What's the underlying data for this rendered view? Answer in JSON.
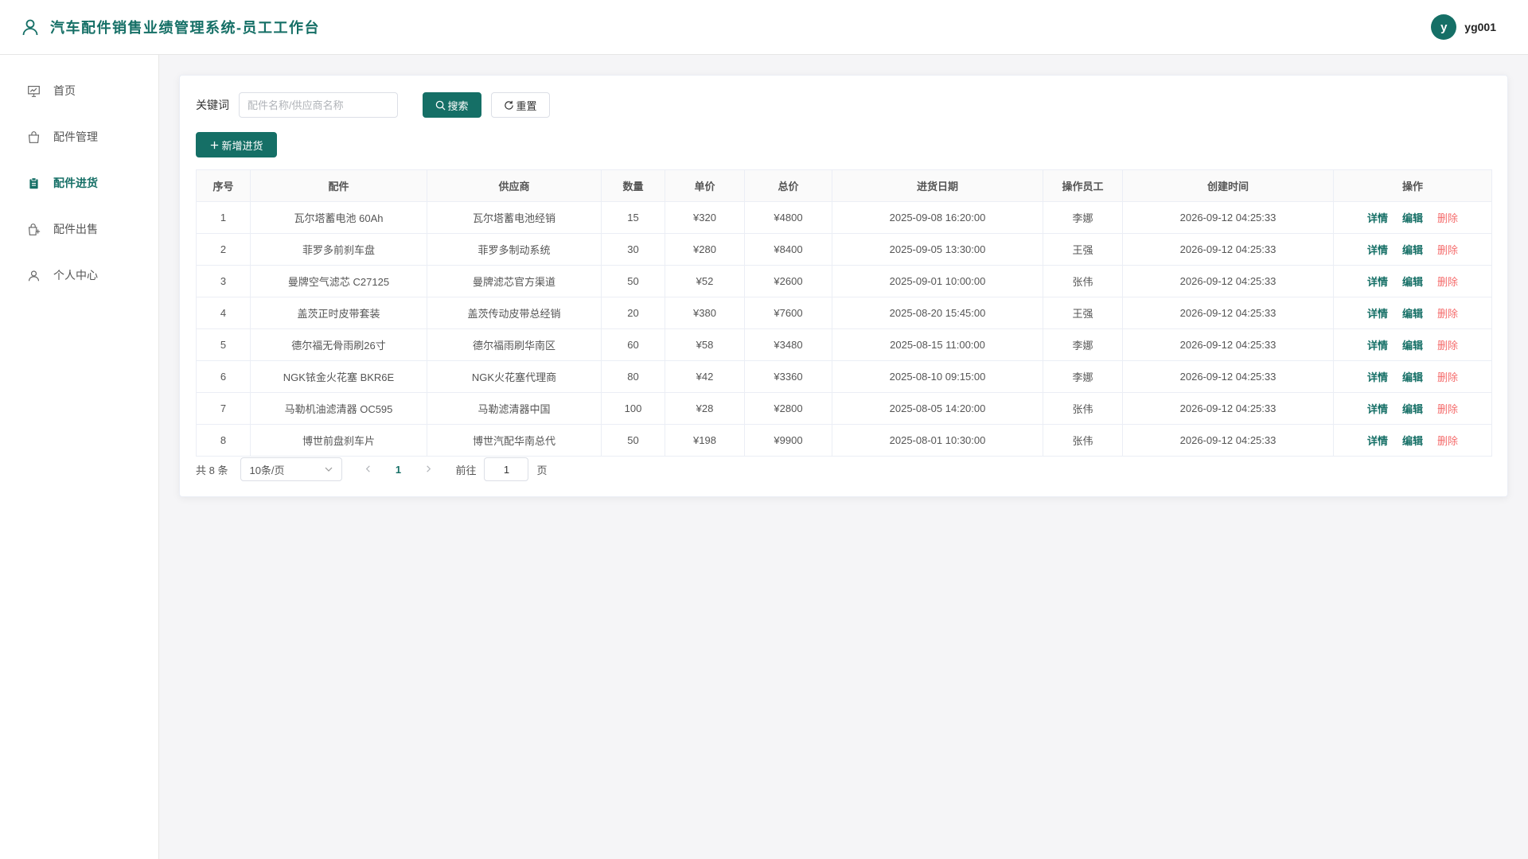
{
  "header": {
    "title": "汽车配件销售业绩管理系统-员工工作台",
    "avatar_letter": "y",
    "username": "yg001"
  },
  "sidebar": {
    "items": [
      {
        "label": "首页",
        "icon": "presentation-icon",
        "active": false
      },
      {
        "label": "配件管理",
        "icon": "shopping-bag-icon",
        "active": false
      },
      {
        "label": "配件进货",
        "icon": "clipboard-icon",
        "active": true
      },
      {
        "label": "配件出售",
        "icon": "sell-bag-icon",
        "active": false
      },
      {
        "label": "个人中心",
        "icon": "user-icon",
        "active": false
      }
    ]
  },
  "search": {
    "label": "关键词",
    "placeholder": "配件名称/供应商名称",
    "search_label": "搜索",
    "reset_label": "重置"
  },
  "toolbar": {
    "add_label": "新增进货"
  },
  "table": {
    "columns": [
      "序号",
      "配件",
      "供应商",
      "数量",
      "单价",
      "总价",
      "进货日期",
      "操作员工",
      "创建时间",
      "操作"
    ],
    "actions": {
      "detail": "详情",
      "edit": "编辑",
      "delete": "删除"
    },
    "rows": [
      [
        "1",
        "瓦尔塔蓄电池 60Ah",
        "瓦尔塔蓄电池经销",
        "15",
        "¥320",
        "¥4800",
        "2025-09-08 16:20:00",
        "李娜",
        "2026-09-12 04:25:33"
      ],
      [
        "2",
        "菲罗多前刹车盘",
        "菲罗多制动系统",
        "30",
        "¥280",
        "¥8400",
        "2025-09-05 13:30:00",
        "王强",
        "2026-09-12 04:25:33"
      ],
      [
        "3",
        "曼牌空气滤芯 C27125",
        "曼牌滤芯官方渠道",
        "50",
        "¥52",
        "¥2600",
        "2025-09-01 10:00:00",
        "张伟",
        "2026-09-12 04:25:33"
      ],
      [
        "4",
        "盖茨正时皮带套装",
        "盖茨传动皮带总经销",
        "20",
        "¥380",
        "¥7600",
        "2025-08-20 15:45:00",
        "王强",
        "2026-09-12 04:25:33"
      ],
      [
        "5",
        "德尔福无骨雨刷26寸",
        "德尔福雨刷华南区",
        "60",
        "¥58",
        "¥3480",
        "2025-08-15 11:00:00",
        "李娜",
        "2026-09-12 04:25:33"
      ],
      [
        "6",
        "NGK铱金火花塞 BKR6E",
        "NGK火花塞代理商",
        "80",
        "¥42",
        "¥3360",
        "2025-08-10 09:15:00",
        "李娜",
        "2026-09-12 04:25:33"
      ],
      [
        "7",
        "马勒机油滤清器 OC595",
        "马勒滤清器中国",
        "100",
        "¥28",
        "¥2800",
        "2025-08-05 14:20:00",
        "张伟",
        "2026-09-12 04:25:33"
      ],
      [
        "8",
        "博世前盘刹车片",
        "博世汽配华南总代",
        "50",
        "¥198",
        "¥9900",
        "2025-08-01 10:30:00",
        "张伟",
        "2026-09-12 04:25:33"
      ]
    ]
  },
  "pagination": {
    "total_text": "共 8 条",
    "page_size": "10条/页",
    "current_page": "1",
    "goto_label": "前往",
    "goto_value": "1",
    "page_unit": "页"
  },
  "colors": {
    "primary": "#156f66",
    "danger": "#f56c6c"
  }
}
